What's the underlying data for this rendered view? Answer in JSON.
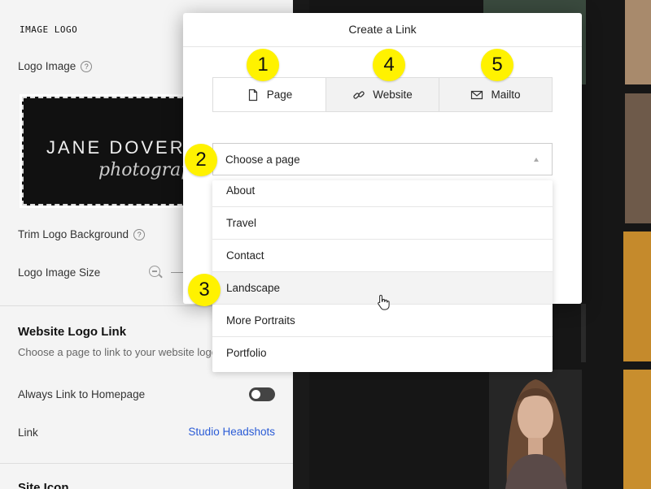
{
  "panel": {
    "image_logo_heading": "IMAGE LOGO",
    "logo_image_label": "Logo Image",
    "logo_preview": {
      "name": "JANE DOVERC",
      "subtitle": "photograph"
    },
    "trim_label": "Trim Logo Background",
    "size_label": "Logo Image Size",
    "website_logo_link": {
      "title": "Website Logo Link",
      "description": "Choose a page to link to your website logo",
      "always_link_label": "Always Link to Homepage",
      "link_label": "Link",
      "link_value": "Studio Headshots"
    },
    "site_icon_title": "Site Icon",
    "help_glyph": "?"
  },
  "modal": {
    "title": "Create a Link",
    "tabs": [
      {
        "label": "Page",
        "icon": "page-icon"
      },
      {
        "label": "Website",
        "icon": "link-icon"
      },
      {
        "label": "Mailto",
        "icon": "mail-icon"
      }
    ],
    "select": {
      "placeholder": "Choose a page"
    }
  },
  "dropdown": {
    "options": [
      "About",
      "Travel",
      "Contact",
      "Landscape",
      "More Portraits",
      "Portfolio"
    ],
    "hovered": "Landscape"
  },
  "badges": [
    "1",
    "2",
    "3",
    "4",
    "5"
  ],
  "colors": {
    "badge": "#fff200",
    "link": "#2b5cd6",
    "panel_bg": "#f4f4f4"
  }
}
